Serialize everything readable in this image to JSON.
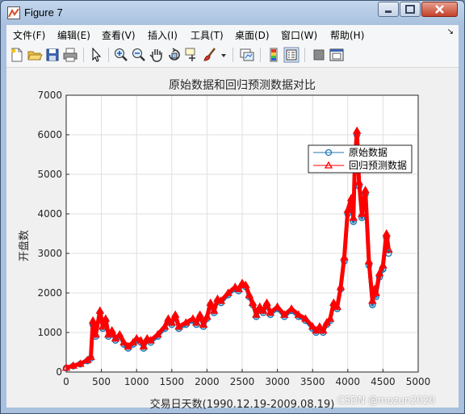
{
  "window": {
    "title": "Figure 7",
    "controls": [
      "minimize",
      "maximize",
      "close"
    ]
  },
  "menubar": {
    "items": [
      {
        "label": "文件(F)"
      },
      {
        "label": "编辑(E)"
      },
      {
        "label": "查看(V)"
      },
      {
        "label": "插入(I)"
      },
      {
        "label": "工具(T)"
      },
      {
        "label": "桌面(D)"
      },
      {
        "label": "窗口(W)"
      },
      {
        "label": "帮助(H)"
      }
    ],
    "dock_arrow": "↘"
  },
  "toolbar": {
    "buttons": [
      {
        "icon": "new-figure-icon"
      },
      {
        "icon": "open-file-icon"
      },
      {
        "icon": "save-icon"
      },
      {
        "icon": "print-icon"
      },
      {
        "icon": "pointer-icon"
      },
      {
        "icon": "zoom-in-icon"
      },
      {
        "icon": "zoom-out-icon"
      },
      {
        "icon": "pan-icon"
      },
      {
        "icon": "rotate-3d-icon"
      },
      {
        "icon": "data-cursor-icon"
      },
      {
        "icon": "brush-icon"
      },
      {
        "icon": "link-plot-icon"
      },
      {
        "icon": "colorbar-icon"
      },
      {
        "icon": "legend-icon"
      },
      {
        "icon": "hide-plot-tools-icon"
      },
      {
        "icon": "show-plot-tools-icon"
      }
    ]
  },
  "chart_data": {
    "type": "line",
    "title": "原始数据和回归预测数据对比",
    "xlabel": "交易日天数(1990.12.19-2009.08.19)",
    "ylabel": "开盘数",
    "xlim": [
      0,
      5000
    ],
    "ylim": [
      0,
      7000
    ],
    "xticks": [
      "0",
      "500",
      "1000",
      "1500",
      "2000",
      "2500",
      "3000",
      "3500",
      "4000",
      "4500",
      "5000"
    ],
    "yticks": [
      "0",
      "1000",
      "2000",
      "3000",
      "4000",
      "5000",
      "6000",
      "7000"
    ],
    "grid": true,
    "legend_position": "top-right",
    "x": [
      0,
      100,
      200,
      300,
      350,
      380,
      420,
      480,
      520,
      560,
      600,
      650,
      700,
      760,
      820,
      880,
      950,
      1000,
      1060,
      1100,
      1150,
      1200,
      1300,
      1400,
      1450,
      1500,
      1550,
      1600,
      1700,
      1800,
      1850,
      1900,
      1950,
      2000,
      2050,
      2100,
      2150,
      2200,
      2300,
      2400,
      2450,
      2500,
      2550,
      2600,
      2650,
      2700,
      2750,
      2800,
      2850,
      2900,
      3000,
      3100,
      3200,
      3300,
      3400,
      3500,
      3550,
      3600,
      3650,
      3700,
      3750,
      3800,
      3850,
      3900,
      3950,
      4000,
      4050,
      4080,
      4100,
      4130,
      4160,
      4200,
      4250,
      4300,
      4350,
      4380,
      4400,
      4450,
      4500,
      4550,
      4580
    ],
    "series": [
      {
        "name": "原始数据",
        "color": "#1f77b4",
        "marker": "circle",
        "values": [
          100,
          150,
          200,
          280,
          350,
          1200,
          900,
          1500,
          1100,
          1300,
          900,
          1000,
          800,
          900,
          700,
          600,
          700,
          800,
          750,
          600,
          800,
          750,
          900,
          1100,
          1300,
          1200,
          1400,
          1100,
          1200,
          1300,
          1200,
          1400,
          1150,
          1350,
          1700,
          1500,
          1800,
          1750,
          1950,
          2100,
          2050,
          2200,
          2150,
          1900,
          1700,
          1400,
          1600,
          1500,
          1700,
          1450,
          1600,
          1400,
          1550,
          1400,
          1300,
          1100,
          1000,
          1100,
          1000,
          1200,
          1300,
          1700,
          1600,
          2100,
          2800,
          4000,
          4300,
          3800,
          5200,
          6000,
          4700,
          3900,
          4500,
          2700,
          1700,
          2000,
          1900,
          2400,
          2600,
          3400,
          3000
        ]
      },
      {
        "name": "回归预测数据",
        "color": "#ff0000",
        "marker": "triangle",
        "values": [
          110,
          160,
          210,
          300,
          380,
          1300,
          950,
          1550,
          1150,
          1350,
          950,
          1050,
          850,
          950,
          750,
          650,
          750,
          850,
          800,
          650,
          850,
          800,
          950,
          1150,
          1350,
          1250,
          1450,
          1150,
          1250,
          1350,
          1250,
          1450,
          1200,
          1400,
          1750,
          1550,
          1850,
          1800,
          2000,
          2150,
          2100,
          2250,
          2200,
          1950,
          1750,
          1450,
          1650,
          1550,
          1750,
          1500,
          1650,
          1450,
          1600,
          1450,
          1350,
          1150,
          1050,
          1150,
          1050,
          1250,
          1350,
          1750,
          1650,
          2150,
          2900,
          4100,
          4400,
          3900,
          5300,
          6100,
          4800,
          4000,
          4600,
          2800,
          1800,
          2100,
          2000,
          2500,
          2700,
          3500,
          3100
        ]
      }
    ]
  },
  "watermark": "CSDN @mozun2020"
}
